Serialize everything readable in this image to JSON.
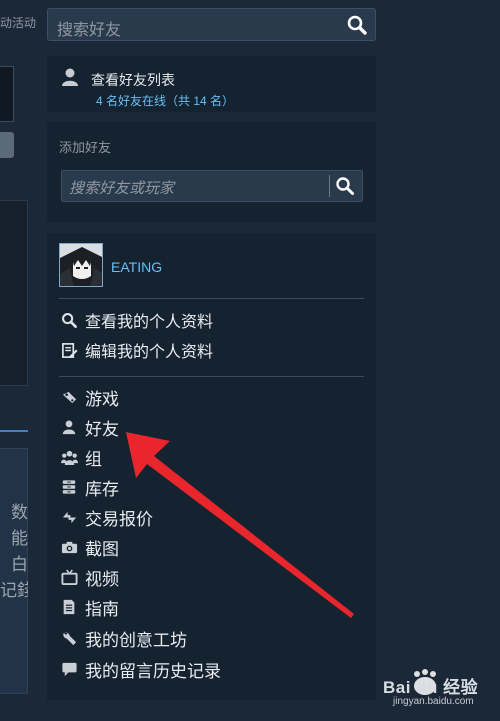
{
  "left": {
    "activity_label": "动活动",
    "snippet_lines": [
      "数",
      "能",
      "白",
      "记錢"
    ]
  },
  "search": {
    "placeholder": "搜索好友"
  },
  "friends_list": {
    "title": "查看好友列表",
    "status": "4 名好友在线（共 14 名）"
  },
  "add_friend": {
    "label": "添加好友",
    "placeholder": "搜索好友或玩家"
  },
  "profile": {
    "username": "EATING",
    "menu_profile": [
      {
        "label": "查看我的个人资料",
        "icon": "search-icon"
      },
      {
        "label": "编辑我的个人资料",
        "icon": "edit-icon"
      }
    ],
    "menu_nav": [
      {
        "label": "游戏",
        "icon": "game-icon"
      },
      {
        "label": "好友",
        "icon": "person-icon"
      },
      {
        "label": "组",
        "icon": "group-icon"
      },
      {
        "label": "库存",
        "icon": "inventory-icon"
      },
      {
        "label": "交易报价",
        "icon": "trade-icon"
      },
      {
        "label": "截图",
        "icon": "camera-icon"
      },
      {
        "label": "视频",
        "icon": "video-icon"
      },
      {
        "label": "指南",
        "icon": "guide-icon"
      },
      {
        "label": "我的创意工坊",
        "icon": "wrench-icon"
      },
      {
        "label": "我的留言历史记录",
        "icon": "comment-icon"
      }
    ]
  },
  "watermark": {
    "brand": "Bai du 经验",
    "url": "jingyan.baidu.com"
  },
  "colors": {
    "background": "#1b2838",
    "panel": "#152230",
    "accent": "#66c0f4",
    "arrow": "#e8262b"
  }
}
